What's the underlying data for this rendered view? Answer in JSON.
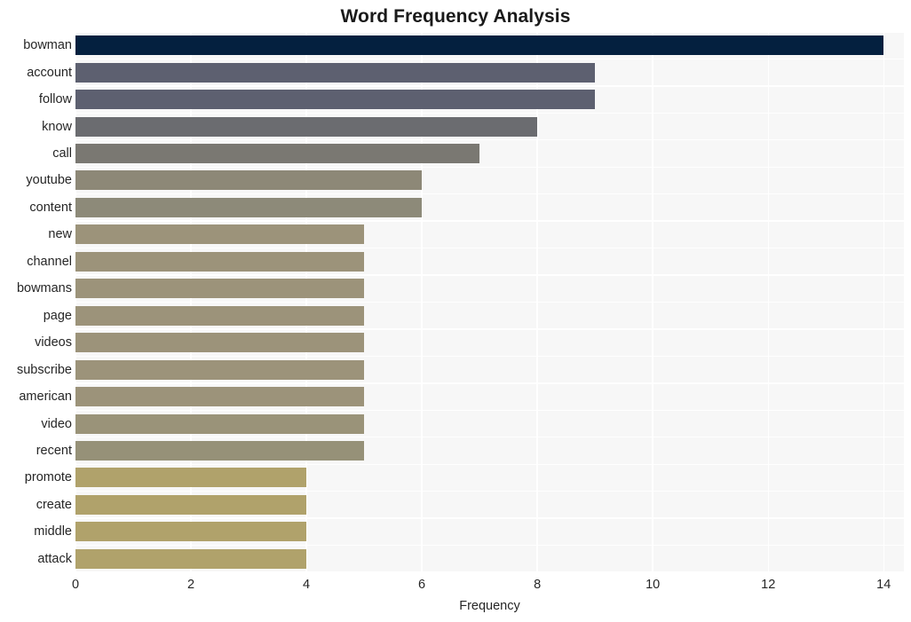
{
  "chart_data": {
    "type": "bar",
    "orientation": "horizontal",
    "title": "Word Frequency Analysis",
    "xlabel": "Frequency",
    "ylabel": "",
    "categories": [
      "bowman",
      "account",
      "follow",
      "know",
      "call",
      "youtube",
      "content",
      "new",
      "channel",
      "bowmans",
      "page",
      "videos",
      "subscribe",
      "american",
      "video",
      "recent",
      "promote",
      "create",
      "middle",
      "attack"
    ],
    "values": [
      14,
      9,
      9,
      8,
      7,
      6,
      6,
      5,
      5,
      5,
      5,
      5,
      5,
      5,
      5,
      5,
      4,
      4,
      4,
      4
    ],
    "bar_colors": [
      "#04203f",
      "#5d6070",
      "#5d6070",
      "#6b6c70",
      "#7a7872",
      "#8d8877",
      "#8d8a79",
      "#9c937a",
      "#9c937a",
      "#9c937a",
      "#9c937a",
      "#9c937a",
      "#9c937a",
      "#9c937a",
      "#9a9379",
      "#969178",
      "#b0a26b",
      "#b0a26b",
      "#b0a26b",
      "#b0a26b"
    ],
    "xlim": [
      0,
      14.35
    ],
    "xticks": [
      0,
      2,
      4,
      6,
      8,
      10,
      12,
      14
    ],
    "xtick_labels": [
      "0",
      "2",
      "4",
      "6",
      "8",
      "10",
      "12",
      "14"
    ],
    "grid": true,
    "grid_color": "#ffffff",
    "plot_background": "#f7f7f7",
    "figure_background": "#ffffff",
    "legend": null
  }
}
